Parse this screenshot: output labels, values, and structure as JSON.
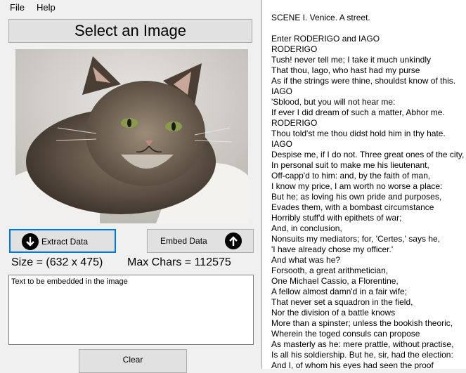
{
  "menu": {
    "file": "File",
    "help": "Help"
  },
  "select_button": "Select an Image",
  "buttons": {
    "extract": "Extract Data",
    "embed": "Embed Data",
    "clear": "Clear"
  },
  "stats": {
    "size": "Size = (632 x 475)",
    "max_chars": "Max Chars = 112575"
  },
  "text_input": {
    "value": "Text to be embedded in the image"
  },
  "script": {
    "title": "SCENE I. Venice. A street.",
    "lines": [
      "Enter RODERIGO and IAGO",
      "RODERIGO",
      "Tush! never tell me; I take it much unkindly",
      "That thou, Iago, who hast had my purse",
      "As if the strings were thine, shouldst know of this.",
      "IAGO",
      "'Sblood, but you will not hear me:",
      "If ever I did dream of such a matter, Abhor me.",
      "RODERIGO",
      "Thou told'st me thou didst hold him in thy hate.",
      "IAGO",
      "Despise me, if I do not. Three great ones of the city,",
      "In personal suit to make me his lieutenant,",
      "Off-capp'd to him: and, by the faith of man,",
      "I know my price, I am worth no worse a place:",
      "But he; as loving his own pride and purposes,",
      "Evades them, with a bombast circumstance",
      "Horribly stuff'd with epithets of war;",
      "And, in conclusion,",
      "Nonsuits my mediators; for, 'Certes,' says he,",
      "'I have already chose my officer.'",
      "And what was he?",
      "Forsooth, a great arithmetician,",
      "One Michael Cassio, a Florentine,",
      "A fellow almost damn'd in a fair wife;",
      "That never set a squadron in the field,",
      "Nor the division of a battle knows",
      "More than a spinster; unless the bookish theoric,",
      "Wherein the toged consuls can propose",
      "As masterly as he: mere prattle, without practise,",
      "Is all his soldiership. But he, sir, had the election:",
      "And I, of whom his eyes had seen the proof"
    ]
  },
  "icons": {
    "extract": "arrow-down-circle-icon",
    "embed": "arrow-up-circle-icon"
  },
  "colors": {
    "focus_border": "#0078d7",
    "button_bg": "#e1e1e1"
  }
}
